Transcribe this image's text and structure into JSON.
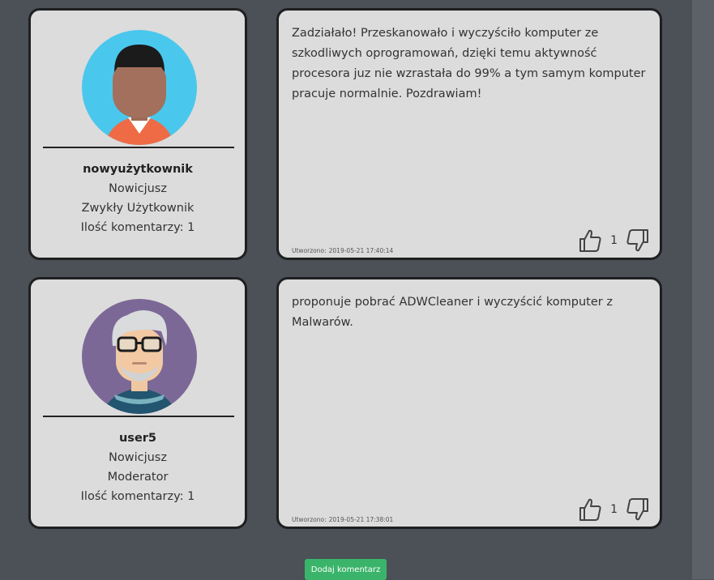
{
  "comments": [
    {
      "user": {
        "username": "nowyużytkownik",
        "rank": "Nowicjusz",
        "role": "Zwykły Użytkownik",
        "comments_count": "Ilość komentarzy: 1"
      },
      "text": "Zadziałało! Przeskanowało i wyczyściło komputer ze szkodliwych oprogramowań, dzięki temu aktywność procesora juz nie wzrastała do 99% a tym samym komputer pracuje normalnie. Pozdrawiam!",
      "created_label": "Utworzono:",
      "created_date": "2019-05-21 17:40:14",
      "votes": "1"
    },
    {
      "user": {
        "username": "user5",
        "rank": "Nowicjusz",
        "role": "Moderator",
        "comments_count": "Ilość komentarzy: 1"
      },
      "text": "proponuje pobrać ADWCleaner i wyczyścić komputer z Malwarów.",
      "created_label": "Utworzono:",
      "created_date": "2019-05-21 17:38:01",
      "votes": "1"
    }
  ],
  "add_comment_label": "Dodaj komentarz",
  "icons": {
    "upvote": "thumbs-up-icon",
    "downvote": "thumbs-down-icon"
  },
  "colors": {
    "background": "#4b5157",
    "card": "#dcdcdc",
    "button": "#3ab46a"
  }
}
